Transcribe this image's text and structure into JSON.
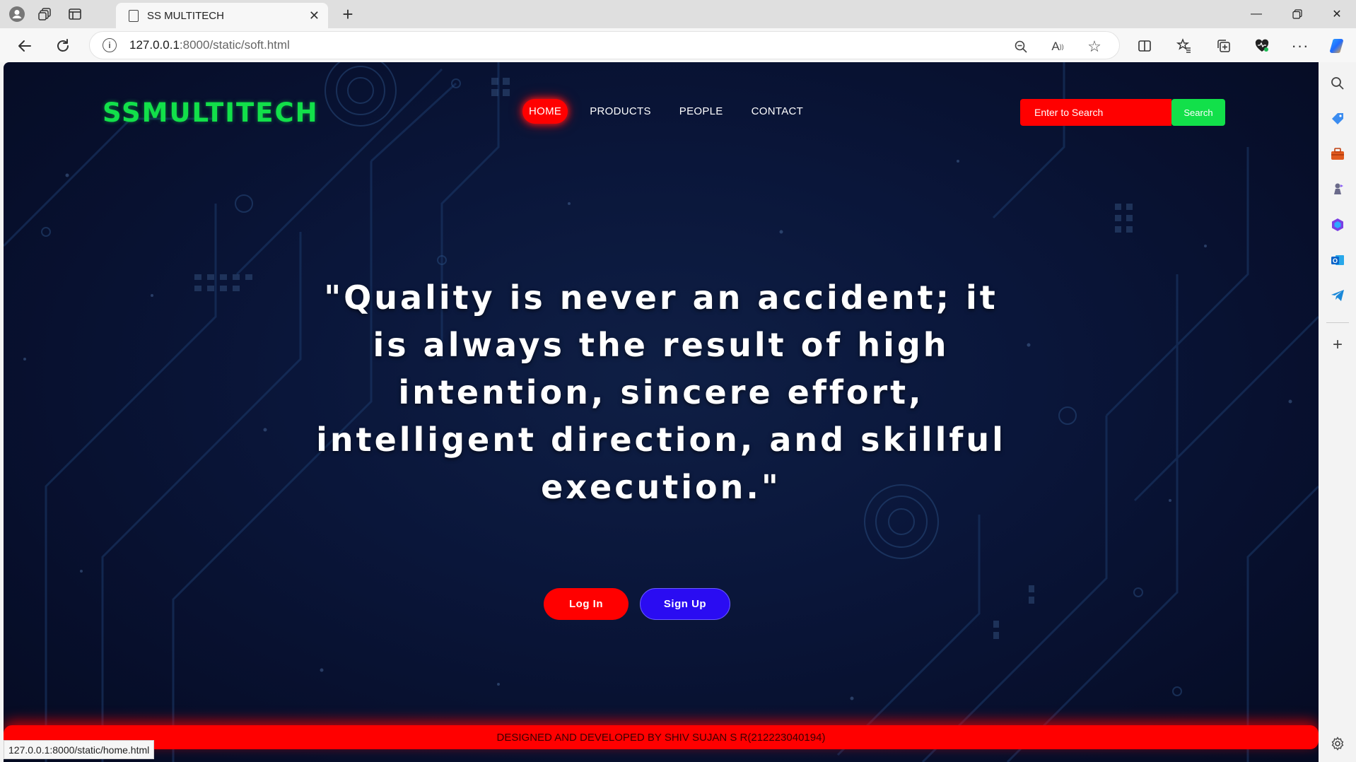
{
  "browser": {
    "tab_title": "SS MULTITECH",
    "url_host": "127.0.0.1",
    "url_path": ":8000/static/soft.html",
    "status_url": "127.0.0.1:8000/static/home.html"
  },
  "site": {
    "logo": "SSMULTITECH",
    "nav": [
      "HOME",
      "PRODUCTS",
      "PEOPLE",
      "CONTACT"
    ],
    "active_nav": "HOME",
    "search": {
      "placeholder": "Enter to Search",
      "button": "Search"
    },
    "quote": "\"Quality is never an accident; it is always the result of high intention, sincere effort, intelligent direction, and skillful execution.\"",
    "buttons": {
      "login": "Log In",
      "signup": "Sign Up"
    },
    "footer": "DESIGNED AND DEVELOPED BY SHIV SUJAN S R(212223040194)"
  },
  "colors": {
    "logo": "#12e04a",
    "accent_red": "#ff0000",
    "accent_green": "#12e04a",
    "signup_blue": "#2a0cf2",
    "background": "#0a163a"
  },
  "icons": {
    "tabstrip": [
      "profile-icon",
      "workspaces-icon",
      "vertical-tabs-icon"
    ],
    "toolbar": [
      "back-icon",
      "refresh-icon",
      "zoom-icon",
      "read-aloud-icon",
      "favorite-star-icon",
      "split-screen-icon",
      "favorites-icon",
      "collections-icon",
      "browser-essentials-icon",
      "more-icon",
      "copilot-icon"
    ],
    "sidebar": [
      "search-icon",
      "shopping-icon",
      "tools-icon",
      "games-icon",
      "microsoft365-icon",
      "outlook-icon",
      "telegram-icon",
      "add-icon",
      "settings-icon"
    ]
  }
}
